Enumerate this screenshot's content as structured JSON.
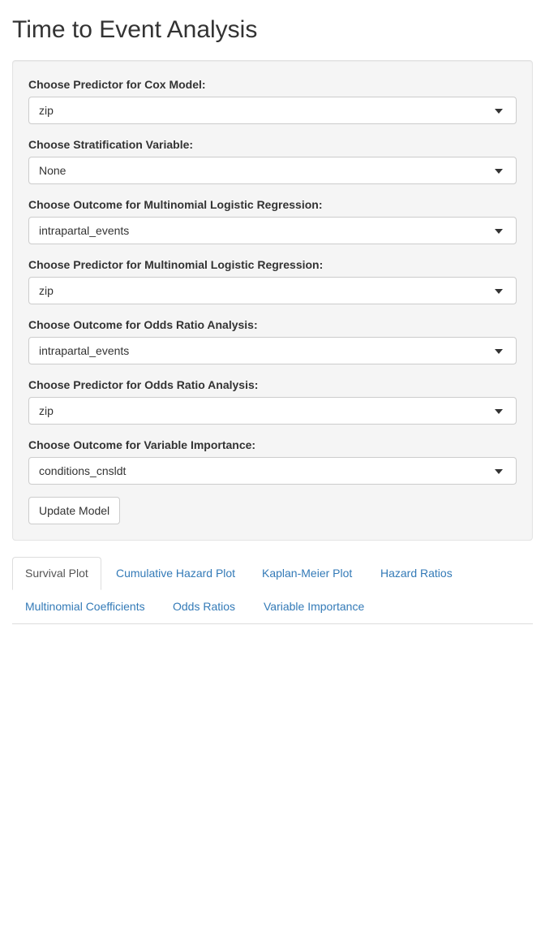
{
  "page": {
    "title": "Time to Event Analysis"
  },
  "form": {
    "fields": [
      {
        "label": "Choose Predictor for Cox Model:",
        "value": "zip"
      },
      {
        "label": "Choose Stratification Variable:",
        "value": "None"
      },
      {
        "label": "Choose Outcome for Multinomial Logistic Regression:",
        "value": "intrapartal_events"
      },
      {
        "label": "Choose Predictor for Multinomial Logistic Regression:",
        "value": "zip"
      },
      {
        "label": "Choose Outcome for Odds Ratio Analysis:",
        "value": "intrapartal_events"
      },
      {
        "label": "Choose Predictor for Odds Ratio Analysis:",
        "value": "zip"
      },
      {
        "label": "Choose Outcome for Variable Importance:",
        "value": "conditions_cnsldt"
      }
    ],
    "update_button": "Update Model"
  },
  "tabs": [
    {
      "label": "Survival Plot",
      "active": true
    },
    {
      "label": "Cumulative Hazard Plot",
      "active": false
    },
    {
      "label": "Kaplan-Meier Plot",
      "active": false
    },
    {
      "label": "Hazard Ratios",
      "active": false
    },
    {
      "label": "Multinomial Coefficients",
      "active": false
    },
    {
      "label": "Odds Ratios",
      "active": false
    },
    {
      "label": "Variable Importance",
      "active": false
    }
  ],
  "colors": {
    "link": "#337ab7",
    "well_background": "#f5f5f5",
    "text": "#333333"
  }
}
